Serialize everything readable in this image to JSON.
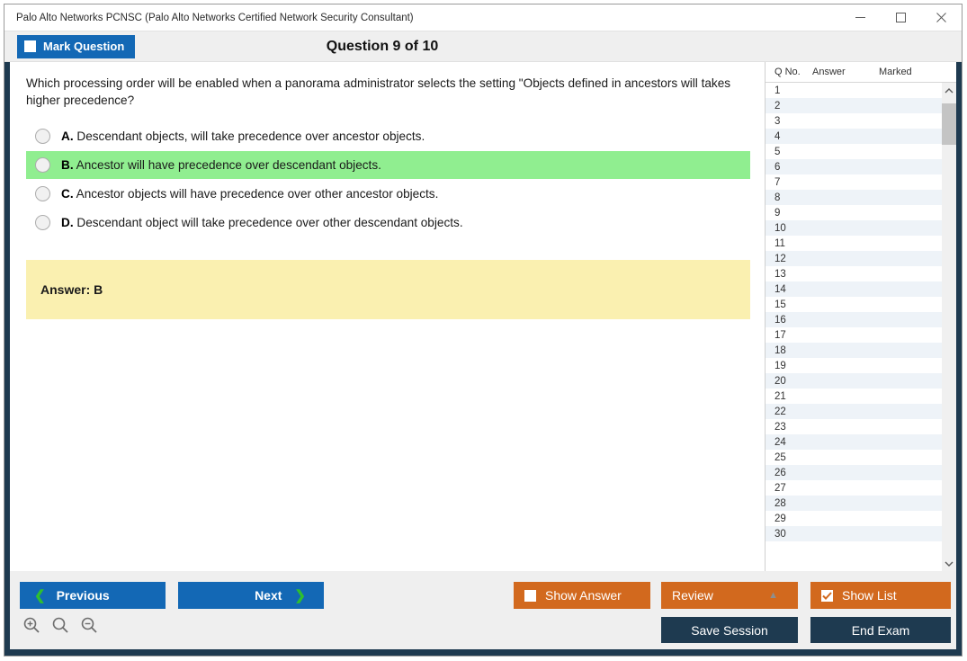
{
  "window": {
    "title": "Palo Alto Networks PCNSC (Palo Alto Networks Certified Network Security Consultant)",
    "minimize_icon": "minimize-icon",
    "maximize_icon": "maximize-icon",
    "close_icon": "close-icon"
  },
  "header": {
    "mark_question_label": "Mark Question",
    "question_counter": "Question 9 of 10"
  },
  "question": {
    "text": "Which processing order will be enabled when a panorama administrator selects the setting \"Objects defined in ancestors will takes higher precedence?",
    "options": [
      {
        "letter": "A.",
        "text": "Descendant objects, will take precedence over ancestor objects.",
        "highlighted": false
      },
      {
        "letter": "B.",
        "text": "Ancestor will have precedence over descendant objects.",
        "highlighted": true
      },
      {
        "letter": "C.",
        "text": "Ancestor objects will have precedence over other ancestor objects.",
        "highlighted": false
      },
      {
        "letter": "D.",
        "text": "Descendant object will take precedence over other descendant objects.",
        "highlighted": false
      }
    ],
    "answer_label": "Answer: B"
  },
  "list_panel": {
    "columns": [
      "Q No.",
      "Answer",
      "Marked"
    ],
    "rows": [
      {
        "no": "1",
        "answer": "",
        "marked": ""
      },
      {
        "no": "2",
        "answer": "",
        "marked": ""
      },
      {
        "no": "3",
        "answer": "",
        "marked": ""
      },
      {
        "no": "4",
        "answer": "",
        "marked": ""
      },
      {
        "no": "5",
        "answer": "",
        "marked": ""
      },
      {
        "no": "6",
        "answer": "",
        "marked": ""
      },
      {
        "no": "7",
        "answer": "",
        "marked": ""
      },
      {
        "no": "8",
        "answer": "",
        "marked": ""
      },
      {
        "no": "9",
        "answer": "",
        "marked": ""
      },
      {
        "no": "10",
        "answer": "",
        "marked": ""
      },
      {
        "no": "11",
        "answer": "",
        "marked": ""
      },
      {
        "no": "12",
        "answer": "",
        "marked": ""
      },
      {
        "no": "13",
        "answer": "",
        "marked": ""
      },
      {
        "no": "14",
        "answer": "",
        "marked": ""
      },
      {
        "no": "15",
        "answer": "",
        "marked": ""
      },
      {
        "no": "16",
        "answer": "",
        "marked": ""
      },
      {
        "no": "17",
        "answer": "",
        "marked": ""
      },
      {
        "no": "18",
        "answer": "",
        "marked": ""
      },
      {
        "no": "19",
        "answer": "",
        "marked": ""
      },
      {
        "no": "20",
        "answer": "",
        "marked": ""
      },
      {
        "no": "21",
        "answer": "",
        "marked": ""
      },
      {
        "no": "22",
        "answer": "",
        "marked": ""
      },
      {
        "no": "23",
        "answer": "",
        "marked": ""
      },
      {
        "no": "24",
        "answer": "",
        "marked": ""
      },
      {
        "no": "25",
        "answer": "",
        "marked": ""
      },
      {
        "no": "26",
        "answer": "",
        "marked": ""
      },
      {
        "no": "27",
        "answer": "",
        "marked": ""
      },
      {
        "no": "28",
        "answer": "",
        "marked": ""
      },
      {
        "no": "29",
        "answer": "",
        "marked": ""
      },
      {
        "no": "30",
        "answer": "",
        "marked": ""
      }
    ],
    "scroll_up_icon": "chevron-up-icon",
    "scroll_down_icon": "chevron-down-icon"
  },
  "footer": {
    "previous_label": "Previous",
    "next_label": "Next",
    "show_answer_label": "Show Answer",
    "show_answer_checked": false,
    "review_label": "Review",
    "show_list_label": "Show List",
    "show_list_checked": true,
    "save_session_label": "Save Session",
    "end_exam_label": "End Exam",
    "zoom_in_icon": "zoom-in-icon",
    "zoom_reset_icon": "zoom-reset-icon",
    "zoom_out_icon": "zoom-out-icon"
  },
  "colors": {
    "primary_blue": "#1368b5",
    "orange": "#d2691e",
    "navy": "#1e3a50",
    "correct_green": "#90ee90",
    "answer_yellow": "#faf0b0",
    "chevron_green": "#2fbf2f"
  }
}
